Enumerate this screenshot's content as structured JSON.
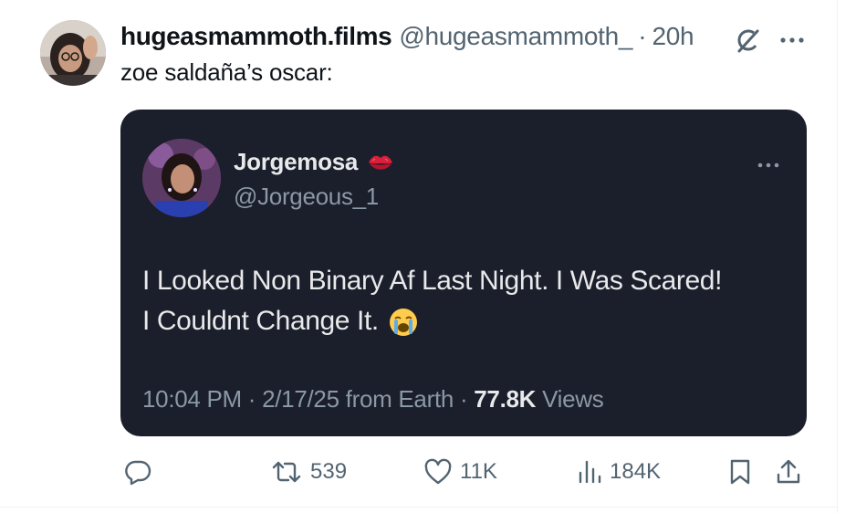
{
  "author": {
    "name": "hugeasmammoth.films",
    "handle": "@hugeasmammoth_",
    "separator": "·",
    "time": "20h"
  },
  "tweet": {
    "text": "zoe saldaña’s oscar:"
  },
  "quoted": {
    "name": "Jorgemosa",
    "handle": "@Jorgeous_1",
    "line1": "I Looked Non Binary Af Last Night. I Was Scared!",
    "line2": "I Couldnt Change It.",
    "meta_prefix": "10:04 PM · 2/17/25 from Earth · ",
    "views_count": "77.8K",
    "views_label": "Views"
  },
  "actions": {
    "retweets": "539",
    "likes": "11K",
    "views": "184K"
  },
  "icons": {
    "grok": "grok-icon",
    "more": "more-icon",
    "kiss": "kiss-mark-icon",
    "emoji": "loudly-crying-face-icon",
    "reply": "reply-icon",
    "retweet": "retweet-icon",
    "like": "heart-icon",
    "views": "bar-chart-icon",
    "bookmark": "bookmark-icon",
    "share": "share-icon"
  },
  "colors": {
    "text": "#0f1419",
    "secondary": "#536471",
    "card_bg": "#1b1e2b",
    "card_text": "#e7e9ea",
    "card_secondary": "#8b98a5",
    "kiss": "#d8203a"
  }
}
